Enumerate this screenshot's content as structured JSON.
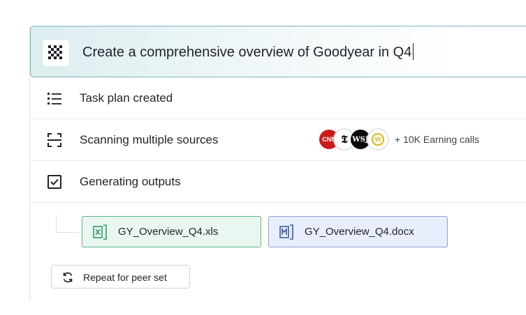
{
  "prompt": {
    "logo_icon": "checker-logo-icon",
    "text": "Create a comprehensive overview of Goodyear in Q4"
  },
  "steps": [
    {
      "icon": "list-icon",
      "label": "Task plan created"
    },
    {
      "icon": "scan-icon",
      "label": "Scanning multiple sources",
      "sources": [
        {
          "name": "cnn-logo",
          "text": "CNN"
        },
        {
          "name": "nyt-logo",
          "text": "𝕿"
        },
        {
          "name": "wsj-logo",
          "text": "WSJ"
        },
        {
          "name": "gold-logo",
          "text": "W"
        }
      ],
      "more": "+ 10K Earning calls"
    },
    {
      "icon": "checkbox-icon",
      "label": "Generating outputs"
    }
  ],
  "outputs": [
    {
      "icon": "excel-file-icon",
      "name": "GY_Overview_Q4.xls",
      "color": "#56b78c"
    },
    {
      "icon": "word-file-icon",
      "name": "GY_Overview_Q4.docx",
      "color": "#3b5aa8"
    }
  ],
  "repeat_button": {
    "icon": "refresh-icon",
    "label": "Repeat for peer set"
  }
}
